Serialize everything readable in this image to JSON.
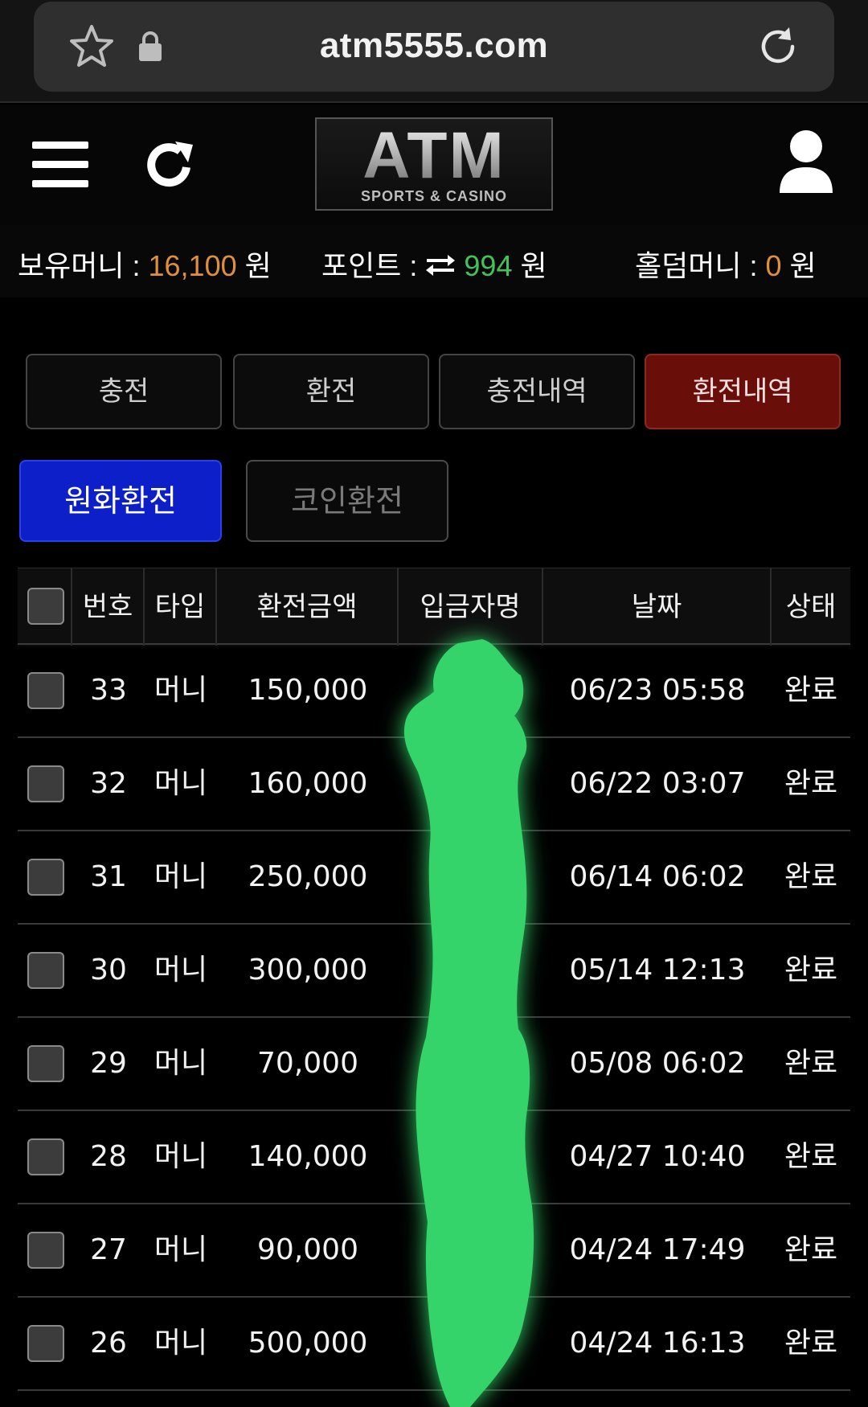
{
  "browser": {
    "url": "atm5555.com"
  },
  "header": {
    "logo_main": "ATM",
    "logo_sub": "SPORTS & CASINO"
  },
  "balance": {
    "money_label": "보유머니 :",
    "money_value": "16,100",
    "money_unit": "원",
    "point_label": "포인트 :",
    "point_value": "994",
    "point_unit": "원",
    "holdem_label": "홀덤머니 :",
    "holdem_value": "0",
    "holdem_unit": "원",
    "colors": {
      "orange": "#e0903c",
      "green": "#44c25a"
    }
  },
  "tabs": [
    {
      "label": "충전"
    },
    {
      "label": "환전"
    },
    {
      "label": "충전내역"
    },
    {
      "label": "환전내역",
      "active": true
    }
  ],
  "sub_tabs": [
    {
      "label": "원화환전",
      "active": true
    },
    {
      "label": "코인환전"
    }
  ],
  "table": {
    "headers": [
      "번호",
      "타입",
      "환전금액",
      "입금자명",
      "날짜",
      "상태"
    ],
    "rows": [
      {
        "num": "33",
        "type": "머니",
        "amount": "150,000",
        "date": "06/23 05:58",
        "status": "완료"
      },
      {
        "num": "32",
        "type": "머니",
        "amount": "160,000",
        "date": "06/22 03:07",
        "status": "완료"
      },
      {
        "num": "31",
        "type": "머니",
        "amount": "250,000",
        "date": "06/14 06:02",
        "status": "완료"
      },
      {
        "num": "30",
        "type": "머니",
        "amount": "300,000",
        "date": "05/14 12:13",
        "status": "완료"
      },
      {
        "num": "29",
        "type": "머니",
        "amount": "70,000",
        "date": "05/08 06:02",
        "status": "완료"
      },
      {
        "num": "28",
        "type": "머니",
        "amount": "140,000",
        "date": "04/27 10:40",
        "status": "완료"
      },
      {
        "num": "27",
        "type": "머니",
        "amount": "90,000",
        "date": "04/24 17:49",
        "status": "완료"
      },
      {
        "num": "26",
        "type": "머니",
        "amount": "500,000",
        "date": "04/24 16:13",
        "status": "완료"
      }
    ]
  },
  "colors": {
    "background": "#000000",
    "active_tab": "#6a0e0a",
    "active_subtab": "#0c1fc8",
    "redaction": "#35d46a"
  }
}
